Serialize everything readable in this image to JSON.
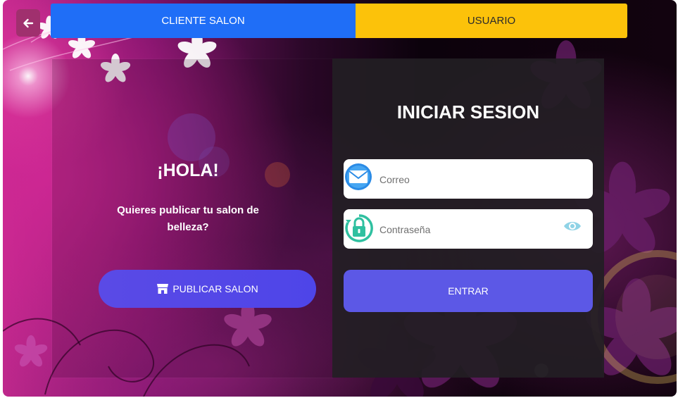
{
  "nav": {
    "back_icon": "arrow-left-icon",
    "tabs": [
      {
        "label": "CLIENTE SALON",
        "color": "#1f6ef7"
      },
      {
        "label": "USUARIO",
        "color": "#fcc20a"
      }
    ]
  },
  "promo": {
    "greeting": "¡HOLA!",
    "message": "Quieres publicar tu salon de belleza?",
    "button_label": "PUBLICAR SALON",
    "button_icon": "store-icon",
    "button_color": "#5a4ae6"
  },
  "login": {
    "title": "INICIAR SESION",
    "email": {
      "placeholder": "Correo",
      "value": "",
      "icon": "envelope-icon"
    },
    "password": {
      "placeholder": "Contraseña",
      "value": "",
      "icon": "padlock-icon",
      "toggle_icon": "eye-icon"
    },
    "submit_label": "ENTRAR",
    "submit_color": "#5c58e6"
  }
}
